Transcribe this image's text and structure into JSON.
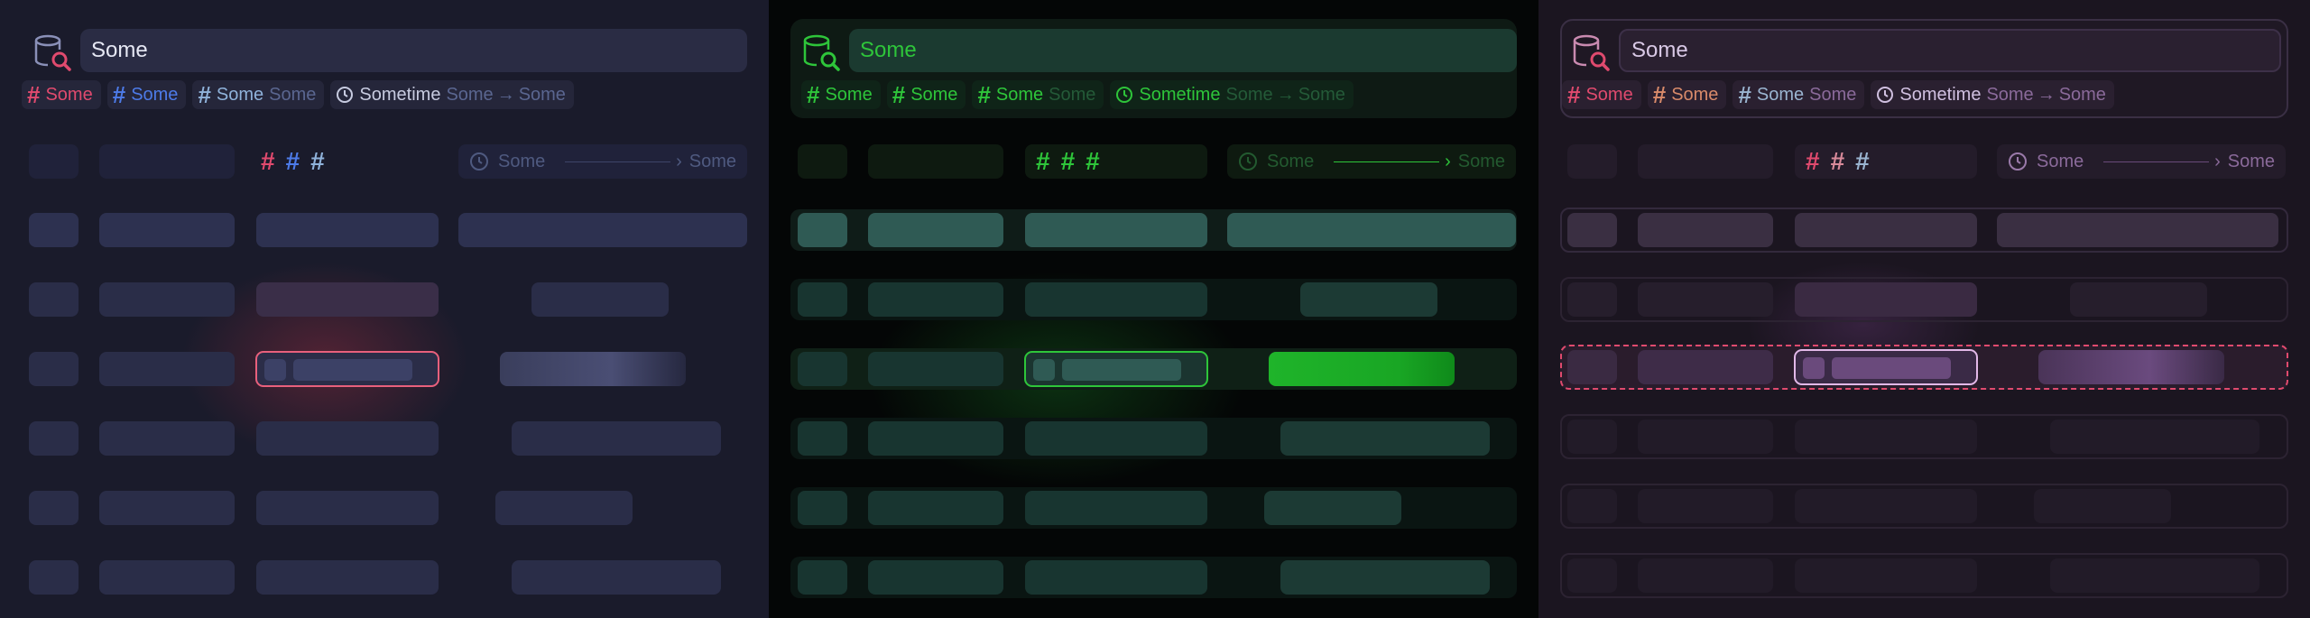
{
  "panels": [
    {
      "theme": "dark-blue",
      "search": {
        "value": "Some"
      },
      "chips": [
        {
          "label": "Some",
          "color": "#e04a6e"
        },
        {
          "label": "Some",
          "color": "#4d7be8"
        },
        {
          "label": "Some",
          "sub": "Some",
          "color": "#7a9bc8"
        },
        {
          "label": "Sometime",
          "from": "Some",
          "to": "Some",
          "color": "#c7cbe0"
        }
      ],
      "header": {
        "time_from": "Some",
        "time_to": "Some"
      }
    },
    {
      "theme": "green",
      "search": {
        "value": "Some"
      },
      "chips": [
        {
          "label": "Some",
          "color": "#2ec53a"
        },
        {
          "label": "Some",
          "color": "#2ec53a"
        },
        {
          "label": "Some",
          "sub": "Some",
          "color": "#2ec53a"
        },
        {
          "label": "Sometime",
          "from": "Some",
          "to": "Some",
          "color": "#2ec53a"
        }
      ],
      "header": {
        "time_from": "Some",
        "time_to": "Some"
      }
    },
    {
      "theme": "purple",
      "search": {
        "value": "Some"
      },
      "chips": [
        {
          "label": "Some",
          "color": "#e04a6e"
        },
        {
          "label": "Some",
          "color": "#d88a6a"
        },
        {
          "label": "Some",
          "sub": "Some",
          "color": "#9ab4d0"
        },
        {
          "label": "Sometime",
          "from": "Some",
          "to": "Some",
          "color": "#d0c0e0"
        }
      ],
      "header": {
        "time_from": "Some",
        "time_to": "Some"
      }
    }
  ],
  "colors": {
    "accent_red": "#e04a6e",
    "accent_blue": "#4d7be8",
    "accent_green": "#2ec53a",
    "accent_purple": "#c89ae0"
  }
}
